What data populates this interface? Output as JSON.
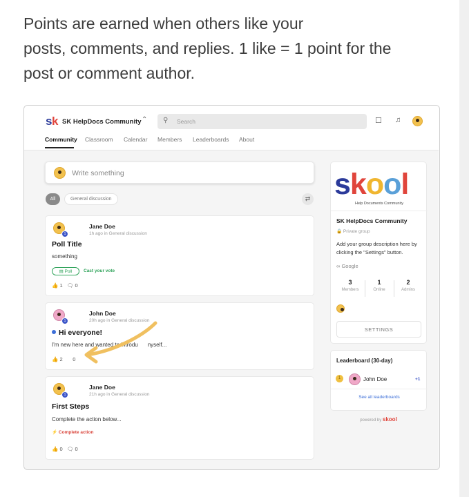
{
  "intro": {
    "line1": "Points are earned when others like your",
    "line2": "posts, comments, and replies. 1 like = 1 point for the",
    "line3": "post or comment author."
  },
  "header": {
    "logo_s": "s",
    "logo_k": "k",
    "community_name": "SK HelpDocs Community",
    "switcher_icon": "⌃⌄",
    "search_placeholder": "Search",
    "icons": [
      "chat-icon",
      "bell-icon",
      "avatar"
    ]
  },
  "tabs": [
    "Community",
    "Classroom",
    "Calendar",
    "Members",
    "Leaderboards",
    "About"
  ],
  "feed": {
    "write_placeholder": "Write something",
    "filters": [
      "All",
      "General discussion"
    ],
    "posts": [
      {
        "author": "Jane Doe",
        "meta": "1h ago in General discussion",
        "title": "Poll Title",
        "body": "something",
        "tag": "Poll",
        "action": "Cast your vote",
        "likes": "1",
        "comments": "0"
      },
      {
        "author": "John Doe",
        "meta": "20h ago in General discussion",
        "title": "Hi everyone!",
        "body": "I'm new here and wanted to introdu",
        "body_tail": "nyself...",
        "likes": "2",
        "comments": "0"
      },
      {
        "author": "Jane Doe",
        "meta": "21h ago in General discussion",
        "title": "First Steps",
        "body": "Complete the action below...",
        "action": "Complete action",
        "likes": "0",
        "comments": "0"
      }
    ]
  },
  "sidebar": {
    "logo_letters": [
      "s",
      "k",
      "o",
      "o",
      "l"
    ],
    "logo_sub": "Help Documents Community",
    "name": "SK HelpDocs Community",
    "privacy": "Private group",
    "description": "Add your group description here by clicking the \"Settings\" button.",
    "link": "Google",
    "stats": [
      {
        "value": "3",
        "label": "Members"
      },
      {
        "value": "1",
        "label": "Online"
      },
      {
        "value": "2",
        "label": "Admins"
      }
    ],
    "settings_label": "SETTINGS"
  },
  "leaderboard": {
    "title": "Leaderboard (30-day)",
    "rank": "1",
    "name": "John Doe",
    "points": "+1",
    "link": "See all leaderboards"
  },
  "powered_by": "powered by",
  "powered_brand": "skool",
  "colors": {
    "accent_blue": "#3d56c8",
    "brand_navy": "#2b3a9a",
    "brand_red": "#e0453c",
    "brand_yellow": "#f0b630",
    "brand_lightblue": "#5aa0d8",
    "poll_green": "#2fa35a",
    "arrow_yellow": "#f0c060"
  }
}
